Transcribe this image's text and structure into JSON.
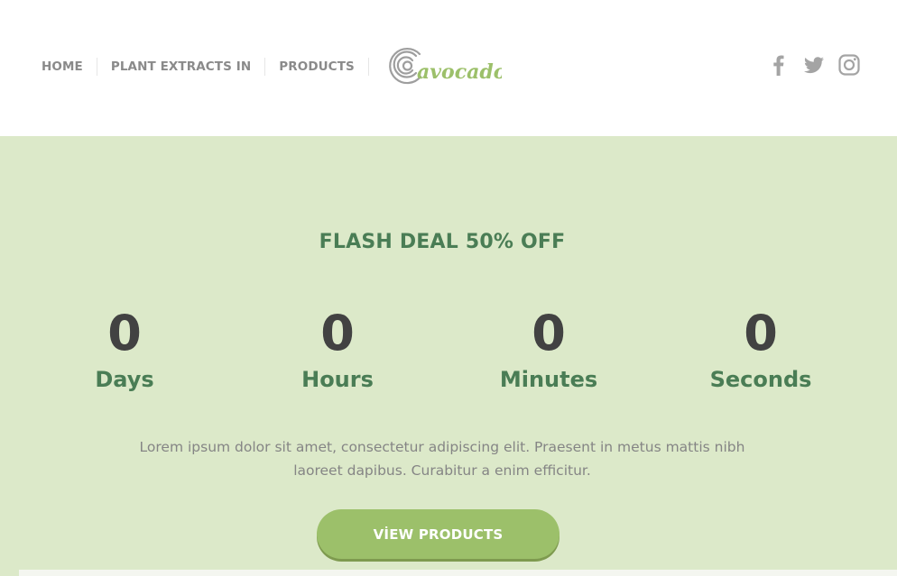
{
  "nav": {
    "items": [
      {
        "label": "HOME"
      },
      {
        "label": "PLANT EXTRACTS IN"
      },
      {
        "label": "PRODUCTS"
      }
    ]
  },
  "logo": {
    "text": "avocado",
    "color": "#9cc06a",
    "swirl_color": "#9e9e9e"
  },
  "social": {
    "icons": [
      "facebook-icon",
      "twitter-icon",
      "instagram-icon"
    ],
    "color": "#a4a4a4"
  },
  "hero": {
    "background": "#dce9c9",
    "title": "FLASH DEAL 50% OFF",
    "countdown": [
      {
        "value": "0",
        "label": "Days"
      },
      {
        "value": "0",
        "label": "Hours"
      },
      {
        "value": "0",
        "label": "Minutes"
      },
      {
        "value": "0",
        "label": "Seconds"
      }
    ],
    "description": "Lorem ipsum dolor sit amet, consectetur adipiscing elit. Praesent in metus mattis nibh laoreet dapibus. Curabitur a enim efficitur.",
    "button_label": "VİEW PRODUCTS",
    "accent": "#4a7d55",
    "button_color": "#9cc06a"
  }
}
